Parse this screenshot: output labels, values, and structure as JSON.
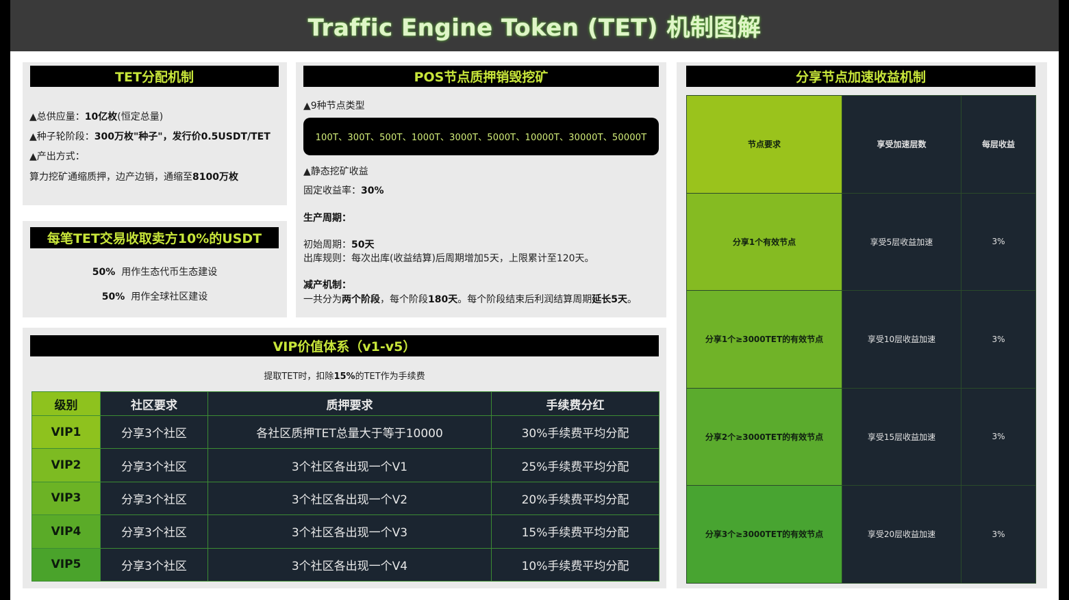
{
  "title": "Traffic Engine Token (TET) 机制图解",
  "distribution": {
    "header": "TET分配机制",
    "supply_label": "▲总供应量：",
    "supply_value": "10亿枚",
    "supply_note": "(恒定总量)",
    "seed_label": "▲种子轮阶段：",
    "seed_value": "300万枚\"种子\"，发行价0.5USDT/TET",
    "output_label": "▲产出方式：",
    "output_desc": "算力挖矿通缩质押，边产边销，通缩至",
    "output_value": "8100万枚"
  },
  "fee": {
    "header": "每笔TET交易收取卖方10%的USDT",
    "line1_pct": "50%",
    "line1_text": "用作生态代币生态建设",
    "line2_pct": "50%",
    "line2_text": "用作全球社区建设"
  },
  "pos": {
    "header": "POS节点质押销毁挖矿",
    "types_label": "▲9种节点类型",
    "types": "100T、300T、500T、1000T、3000T、5000T、10000T、30000T、50000T",
    "static_label": "▲静态挖矿收益",
    "fixed_label": "固定收益率：",
    "fixed_value": "30%",
    "cycle_label": "生产周期：",
    "initial_label": "初始周期：",
    "initial_value": "50天",
    "rule_text": "出库规则：每次出库(收益结算)后周期增加5天，上限累计至120天。",
    "reduce_label": "减产机制：",
    "reduce_p1": "一共分为",
    "reduce_b1": "两个阶段",
    "reduce_p2": "，每个阶段",
    "reduce_b2": "180天",
    "reduce_p3": "。每个阶段结束后利润结算周期",
    "reduce_b3": "延长5天",
    "reduce_p4": "。"
  },
  "vip": {
    "header": "VIP价值体系（v1-v5）",
    "note_p1": "提取TET时，扣除",
    "note_b": "15%",
    "note_p2": "的TET作为手续费",
    "columns": [
      "级别",
      "社区要求",
      "质押要求",
      "手续费分红"
    ],
    "rows": [
      {
        "level": "VIP1",
        "community": "分享3个社区",
        "stake": "各社区质押TET总量大于等于10000",
        "dividend": "30%手续费平均分配"
      },
      {
        "level": "VIP2",
        "community": "分享3个社区",
        "stake": "3个社区各出现一个V1",
        "dividend": "25%手续费平均分配"
      },
      {
        "level": "VIP3",
        "community": "分享3个社区",
        "stake": "3个社区各出现一个V2",
        "dividend": "20%手续费平均分配"
      },
      {
        "level": "VIP4",
        "community": "分享3个社区",
        "stake": "3个社区各出现一个V3",
        "dividend": "15%手续费平均分配"
      },
      {
        "level": "VIP5",
        "community": "分享3个社区",
        "stake": "3个社区各出现一个V4",
        "dividend": "10%手续费平均分配"
      }
    ]
  },
  "share": {
    "header": "分享节点加速收益机制",
    "columns": [
      "节点要求",
      "享受加速层数",
      "每层收益"
    ],
    "rows": [
      {
        "req": "分享1个有效节点",
        "layers": "享受5层收益加速",
        "yield": "3%"
      },
      {
        "req": "分享1个≥3000TET的有效节点",
        "layers": "享受10层收益加速",
        "yield": "3%"
      },
      {
        "req": "分享2个≥3000TET的有效节点",
        "layers": "享受15层收益加速",
        "yield": "3%"
      },
      {
        "req": "分享3个≥3000TET的有效节点",
        "layers": "享受20层收益加速",
        "yield": "3%"
      }
    ]
  },
  "colors": {
    "accent_green": "#c8e63a",
    "dark_cell": "#1b2530",
    "vip_level_gradient": [
      "#8ec21e",
      "#7dbb22",
      "#6cb325",
      "#5aab28",
      "#4aa32b"
    ],
    "share_req_gradient": [
      "#9ac31c",
      "#85bb22",
      "#70b328",
      "#5bab2d",
      "#48a431"
    ]
  }
}
